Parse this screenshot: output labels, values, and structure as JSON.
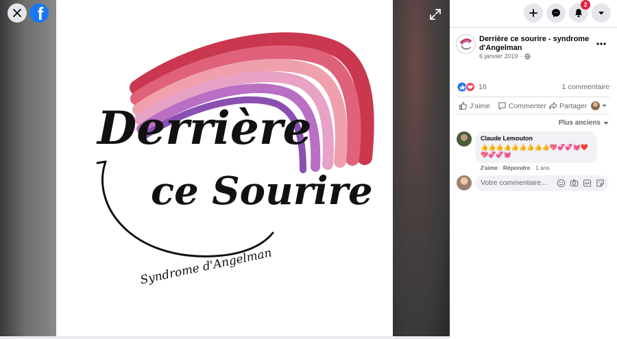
{
  "viewer": {
    "artwork": {
      "line1": "Derrière",
      "line2": "ce Sourire",
      "subtitle": "Syndrome d'Angelman",
      "brush_colors": [
        "#c9384f",
        "#e0617a",
        "#f0a0ad",
        "#e8a2c6",
        "#b86fc4",
        "#8a4fb0"
      ]
    }
  },
  "topbar": {
    "notifications_badge": "2"
  },
  "post": {
    "page_name": "Derrière ce sourire - syndrome d'Angelman",
    "date": "6 janvier 2019",
    "reactions_count": "16",
    "comments_count": "1 commentaire",
    "actions": {
      "like": "J'aime",
      "comment": "Commenter",
      "share": "Partager"
    },
    "sort_label": "Plus anciens"
  },
  "comment": {
    "author": "Claude Lemouton",
    "text": "👍👍👍👍👍👍👍👍👍💖💞💞💓❤️💖💞💞💓",
    "like": "J'aime",
    "reply": "Répondre",
    "time": "1 ans"
  },
  "composer": {
    "placeholder": "Votre commentaire..."
  },
  "colors": {
    "facebook_blue": "#1877f2",
    "badge_red": "#e41e3f"
  }
}
